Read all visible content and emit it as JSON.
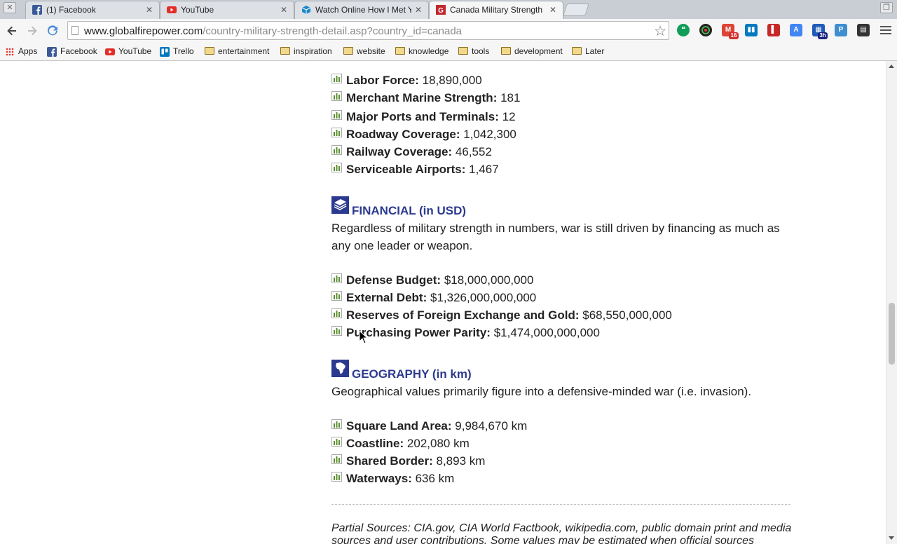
{
  "browser": {
    "tabs": [
      {
        "title": "(1) Facebook",
        "icon": "facebook-icon"
      },
      {
        "title": "YouTube",
        "icon": "youtube-icon"
      },
      {
        "title": "Watch Online How I Met Y",
        "icon": "cube-icon"
      },
      {
        "title": "Canada Military Strength",
        "icon": "gfp-icon"
      }
    ],
    "active_tab_index": 3,
    "url_host": "www.globalfirepower.com",
    "url_path": "/country-military-strength-detail.asp?country_id=canada",
    "extensions": [
      "hangouts-icon",
      "chromecast-icon",
      "gmail-icon",
      "trello-icon",
      "bookmark-red-icon",
      "translate-icon",
      "calendar-icon",
      "pocket-icon",
      "film-icon"
    ],
    "gmail_badge": "16",
    "calendar_badge": "3h",
    "bookmarks": [
      {
        "label": "Apps",
        "type": "apps"
      },
      {
        "label": "Facebook",
        "type": "facebook"
      },
      {
        "label": "YouTube",
        "type": "youtube"
      },
      {
        "label": "Trello",
        "type": "trello"
      },
      {
        "label": "entertainment",
        "type": "folder"
      },
      {
        "label": "inspiration",
        "type": "folder"
      },
      {
        "label": "website",
        "type": "folder"
      },
      {
        "label": "knowledge",
        "type": "folder"
      },
      {
        "label": "tools",
        "type": "folder"
      },
      {
        "label": "development",
        "type": "folder"
      },
      {
        "label": "Later",
        "type": "folder"
      }
    ]
  },
  "page": {
    "logistics_stats": [
      {
        "label": "Labor Force:",
        "value": "18,890,000"
      },
      {
        "label": "Merchant Marine Strength:",
        "value": "181"
      },
      {
        "label": "Major Ports and Terminals:",
        "value": "12"
      },
      {
        "label": "Roadway Coverage:",
        "value": "1,042,300"
      },
      {
        "label": "Railway Coverage:",
        "value": "46,552"
      },
      {
        "label": "Serviceable Airports:",
        "value": "1,467"
      }
    ],
    "financial": {
      "title": "FINANCIAL (in USD)",
      "description": "Regardless of military strength in numbers, war is still driven by financing as much as any one leader or weapon.",
      "stats": [
        {
          "label": "Defense Budget:",
          "value": "$18,000,000,000"
        },
        {
          "label": "External Debt:",
          "value": "$1,326,000,000,000"
        },
        {
          "label": "Reserves of Foreign Exchange and Gold:",
          "value": "$68,550,000,000"
        },
        {
          "label": "Purchasing Power Parity:",
          "value": "$1,474,000,000,000"
        }
      ]
    },
    "geography": {
      "title": "GEOGRAPHY (in km)",
      "description": "Geographical values primarily figure into a defensive-minded war (i.e. invasion).",
      "stats": [
        {
          "label": "Square Land Area:",
          "value": "9,984,670 km"
        },
        {
          "label": "Coastline:",
          "value": "202,080 km"
        },
        {
          "label": "Shared Border:",
          "value": "8,893 km"
        },
        {
          "label": "Waterways:",
          "value": "636 km"
        }
      ]
    },
    "sources": "Partial Sources: CIA.gov, CIA World Factbook, wikipedia.com, public domain print and media sources and user contributions. Some values may be estimated when official sources"
  },
  "colors": {
    "accent": "#2b3a8f",
    "stat_icon": "#5a8f2e"
  }
}
